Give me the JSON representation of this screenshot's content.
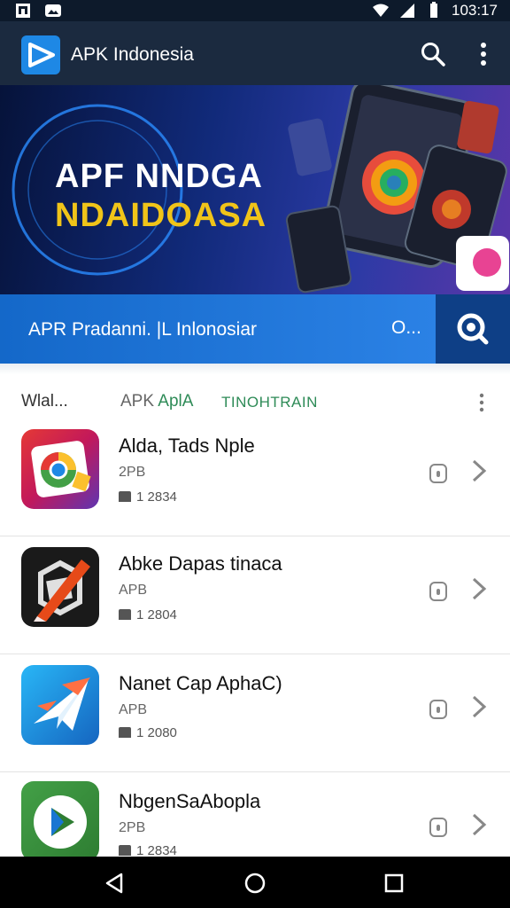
{
  "status_bar": {
    "time": "103:17"
  },
  "app_bar": {
    "title": "APK Indonesia"
  },
  "banner": {
    "line1": "APF NNDGA",
    "line2": "NDAIDOASA"
  },
  "search": {
    "text": "APR  Pradanni. |L Inlonosiar",
    "dots": "O..."
  },
  "tabs": {
    "a": "Wlal...",
    "b1": "APK",
    "b2": "AplA",
    "c": "TINOHTRAIN"
  },
  "apps": [
    {
      "name": "Alda, Tads Nple",
      "sub": "2PB",
      "meta": "1 2834"
    },
    {
      "name": "Abke Dapas tinaca",
      "sub": "APB",
      "meta": "1 2804"
    },
    {
      "name": "Nanet Cap  AphaC)",
      "sub": "APB",
      "meta": "1 2080"
    },
    {
      "name": "NbgenSaAbopla",
      "sub": "2PB",
      "meta": "1 2834"
    }
  ],
  "colors": {
    "app_bar": "#1b2a3f",
    "search_bar": "#1f77dc",
    "accent_green": "#2e8b57",
    "banner_gold": "#f0c419"
  }
}
